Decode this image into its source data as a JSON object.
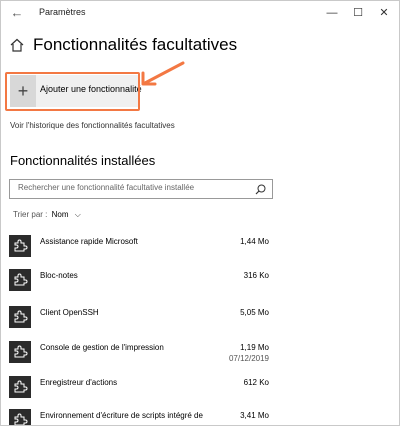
{
  "window": {
    "title": "Paramètres",
    "controls": {
      "minimize": "—",
      "maximize": "☐",
      "close": "✕"
    }
  },
  "header": {
    "title": "Fonctionnalités facultatives"
  },
  "add_button": {
    "label": "Ajouter une fonctionnalité",
    "icon": "plus-icon"
  },
  "history_link": "Voir l'historique des fonctionnalités facultatives",
  "installed": {
    "title": "Fonctionnalités installées",
    "search_placeholder": "Rechercher une fonctionnalité facultative installée",
    "sort_label": "Trier par :",
    "sort_value": "Nom",
    "items": [
      {
        "name": "Assistance rapide Microsoft",
        "size": "1,44 Mo",
        "date": ""
      },
      {
        "name": "Bloc-notes",
        "size": "316 Ko",
        "date": ""
      },
      {
        "name": "Client OpenSSH",
        "size": "5,05 Mo",
        "date": ""
      },
      {
        "name": "Console de gestion de l'impression",
        "size": "1,19 Mo",
        "date": "07/12/2019"
      },
      {
        "name": "Enregistreur d'actions",
        "size": "612 Ko",
        "date": ""
      },
      {
        "name": "Environnement d'écriture de scripts intégré de",
        "size": "3,41 Mo",
        "date": ""
      }
    ]
  },
  "colors": {
    "highlight": "#f37843",
    "icon_bg": "#2b2b2b"
  }
}
